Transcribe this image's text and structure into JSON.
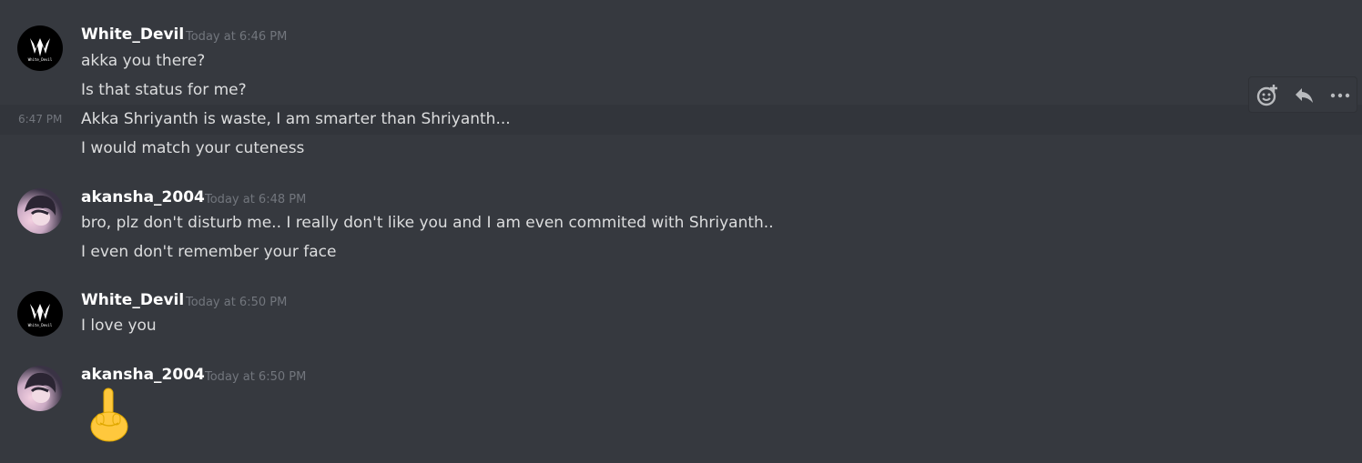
{
  "messages": [
    {
      "user": "White_Devil",
      "time": "Today at 6:46 PM",
      "lines": [
        "akka you there?",
        "Is that status for me?",
        "Akka Shriyanth is waste,  I am smarter than Shriyanth...",
        "I would match your cuteness"
      ],
      "hover_time": "6:47 PM"
    },
    {
      "user": "akansha_2004",
      "time": "Today at 6:48 PM",
      "lines": [
        "bro, plz don't disturb me.. I really don't like you and I am even commited with Shriyanth..",
        "I even don't remember your face"
      ]
    },
    {
      "user": "White_Devil",
      "time": "Today at 6:50 PM",
      "lines": [
        "I love you"
      ]
    },
    {
      "user": "akansha_2004",
      "time": "Today at 6:50 PM",
      "emoji": "middle-finger-emoji"
    }
  ],
  "avatar_text": "White_Devil",
  "toolbar": {
    "icons": [
      "add-reaction-icon",
      "reply-icon",
      "more-options-icon"
    ]
  },
  "colors": {
    "background": "#36393f",
    "hover_row": "#32353b",
    "username": "#ffffff",
    "message_text": "#dcddde",
    "timestamp": "#72767d",
    "toolbar_icon": "#b9bbbe"
  }
}
